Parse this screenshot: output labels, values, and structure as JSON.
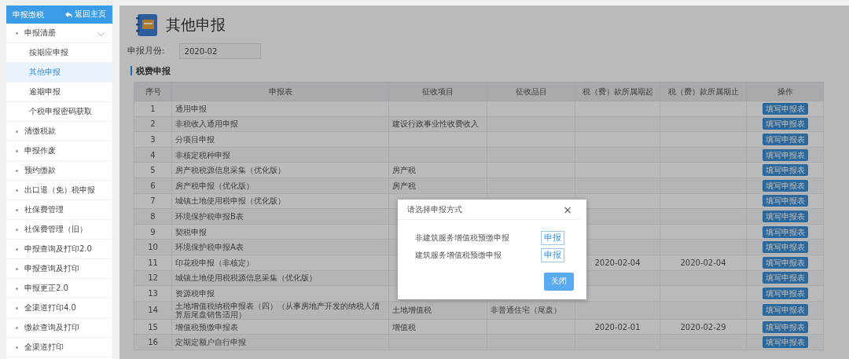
{
  "sidebar": {
    "title": "申报缴税",
    "back_label": "返回主页",
    "items": [
      {
        "label": "申报清册",
        "expanded": true,
        "children": [
          {
            "label": "按期应申报",
            "selected": false
          },
          {
            "label": "其他申报",
            "selected": true
          },
          {
            "label": "逾期申报",
            "selected": false
          },
          {
            "label": "个税申报密码获取",
            "selected": false
          }
        ]
      },
      {
        "label": "清缴税款"
      },
      {
        "label": "申报作废"
      },
      {
        "label": "预约缴款"
      },
      {
        "label": "出口退（免）税申报"
      },
      {
        "label": "社保费管理"
      },
      {
        "label": "社保费管理（旧）"
      },
      {
        "label": "申报查询及打印2.0"
      },
      {
        "label": "申报查询及打印"
      },
      {
        "label": "申报更正2.0"
      },
      {
        "label": "全渠道打印4.0"
      },
      {
        "label": "缴款查询及打印"
      },
      {
        "label": "全渠道打印"
      }
    ]
  },
  "page": {
    "title": "其他申报",
    "month_label": "申报月份:",
    "month_value": "2020-02",
    "section_title": "税费申报"
  },
  "table": {
    "columns": [
      "序号",
      "申报表",
      "征收项目",
      "征收品目",
      "税（费）款所属期起",
      "税（费）款所属期止",
      "操作"
    ],
    "rows": [
      {
        "no": "1",
        "form": "通用申报",
        "levy_item": "",
        "levy_subitem": "",
        "period_start": "",
        "period_end": "",
        "action": "填写申报表"
      },
      {
        "no": "2",
        "form": "非税收入通用申报",
        "levy_item": "建设行政事业性收费收入",
        "levy_subitem": "",
        "period_start": "",
        "period_end": "",
        "action": "填写申报表"
      },
      {
        "no": "3",
        "form": "分项目申报",
        "levy_item": "",
        "levy_subitem": "",
        "period_start": "",
        "period_end": "",
        "action": "填写申报表"
      },
      {
        "no": "4",
        "form": "非核定税种申报",
        "levy_item": "",
        "levy_subitem": "",
        "period_start": "",
        "period_end": "",
        "action": "填写申报表"
      },
      {
        "no": "5",
        "form": "房产税税源信息采集（优化版）",
        "levy_item": "房产税",
        "levy_subitem": "",
        "period_start": "",
        "period_end": "",
        "action": "填写申报表"
      },
      {
        "no": "6",
        "form": "房产税申报（优化版）",
        "levy_item": "房产税",
        "levy_subitem": "",
        "period_start": "",
        "period_end": "",
        "action": "填写申报表"
      },
      {
        "no": "7",
        "form": "城镇土地使用税申报（优化版）",
        "levy_item": "",
        "levy_subitem": "",
        "period_start": "",
        "period_end": "",
        "action": "填写申报表"
      },
      {
        "no": "8",
        "form": "环境保护税申报B表",
        "levy_item": "",
        "levy_subitem": "",
        "period_start": "",
        "period_end": "",
        "action": "填写申报表"
      },
      {
        "no": "9",
        "form": "契税申报",
        "levy_item": "",
        "levy_subitem": "",
        "period_start": "",
        "period_end": "",
        "action": "填写申报表"
      },
      {
        "no": "10",
        "form": "环境保护税申报A表",
        "levy_item": "",
        "levy_subitem": "",
        "period_start": "",
        "period_end": "",
        "action": "填写申报表"
      },
      {
        "no": "11",
        "form": "印花税申报（非核定）",
        "levy_item": "",
        "levy_subitem": "",
        "period_start": "2020-02-04",
        "period_end": "2020-02-04",
        "action": "填写申报表"
      },
      {
        "no": "12",
        "form": "城镇土地使用税税源信息采集（优化版）",
        "levy_item": "",
        "levy_subitem": "",
        "period_start": "",
        "period_end": "",
        "action": "填写申报表"
      },
      {
        "no": "13",
        "form": "资源税申报",
        "levy_item": "",
        "levy_subitem": "",
        "period_start": "",
        "period_end": "",
        "action": "填写申报表"
      },
      {
        "no": "14",
        "form": "土地增值税纳税申报表（四）（从事房地产开发的纳税人清算后尾盘销售适用）",
        "levy_item": "土地增值税",
        "levy_subitem": "非普通住宅（尾盘）",
        "period_start": "",
        "period_end": "",
        "action": "填写申报表"
      },
      {
        "no": "15",
        "form": "增值税预缴申报表",
        "levy_item": "增值税",
        "levy_subitem": "",
        "period_start": "2020-02-01",
        "period_end": "2020-02-29",
        "action": "填写申报表"
      },
      {
        "no": "16",
        "form": "定期定额户自行申报",
        "levy_item": "",
        "levy_subitem": "",
        "period_start": "",
        "period_end": "",
        "action": "填写申报表"
      }
    ]
  },
  "dialog": {
    "title": "请选择申报方式",
    "close_icon": "×",
    "options": [
      {
        "label": "非建筑服务增值税预缴申报",
        "button": "申报"
      },
      {
        "label": "建筑服务增值税预缴申报",
        "button": "申报"
      }
    ],
    "close_button": "关闭"
  }
}
